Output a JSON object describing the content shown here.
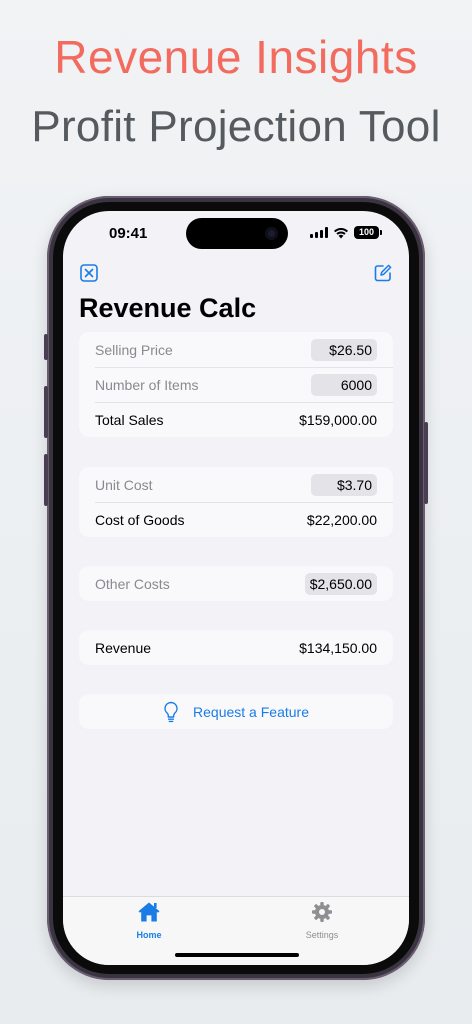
{
  "promo": {
    "title": "Revenue Insights",
    "subtitle": "Profit Projection Tool"
  },
  "status_bar": {
    "time": "09:41",
    "battery": "100"
  },
  "nav": {
    "left_icon": "close-square-icon",
    "right_icon": "edit-icon"
  },
  "page": {
    "title": "Revenue Calc"
  },
  "sales_section": {
    "selling_price_label": "Selling Price",
    "selling_price_value": "$26.50",
    "items_label": "Number of Items",
    "items_value": "6000",
    "total_sales_label": "Total Sales",
    "total_sales_value": "$159,000.00"
  },
  "cost_section": {
    "unit_cost_label": "Unit Cost",
    "unit_cost_value": "$3.70",
    "cogs_label": "Cost of Goods",
    "cogs_value": "$22,200.00"
  },
  "other_section": {
    "other_costs_label": "Other Costs",
    "other_costs_value": "$2,650.00"
  },
  "revenue_section": {
    "revenue_label": "Revenue",
    "revenue_value": "$134,150.00"
  },
  "feature": {
    "label": "Request a Feature",
    "icon": "lightbulb-icon"
  },
  "tabbar": {
    "home_label": "Home",
    "settings_label": "Settings"
  },
  "colors": {
    "accent": "#1a7de6",
    "promo_title": "#f26b5e",
    "promo_subtitle": "#555a5e",
    "inactive_tab": "#8e8e93"
  }
}
